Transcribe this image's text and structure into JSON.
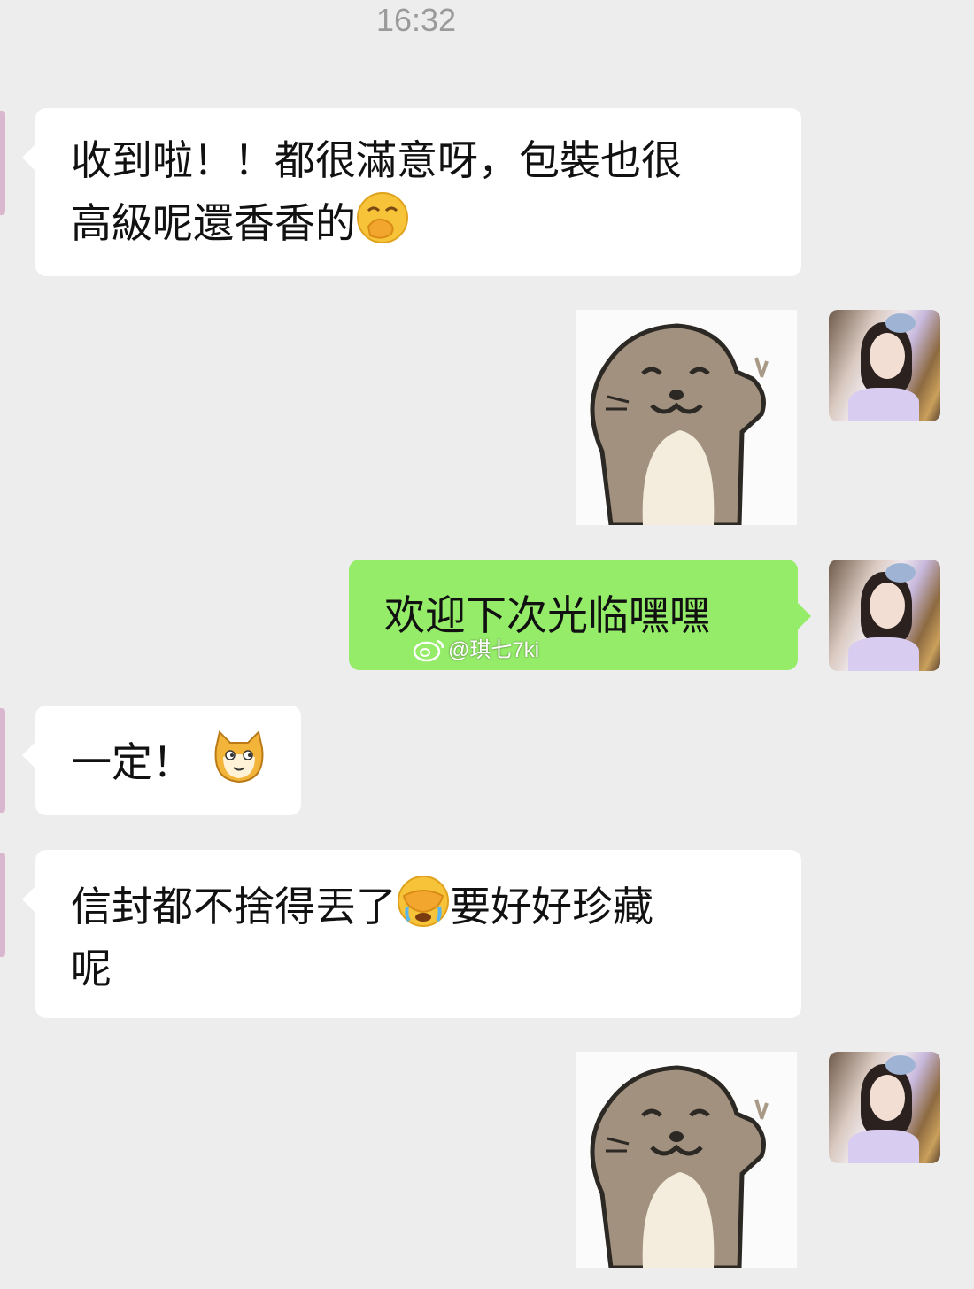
{
  "header": {
    "time": "16:32"
  },
  "messages": [
    {
      "side": "left",
      "type": "text",
      "line1": "收到啦！！都很滿意呀，包裝也很",
      "line2": "高級呢還香香的",
      "emoji": "hand-over-mouth-emoji"
    },
    {
      "side": "right",
      "type": "sticker",
      "sticker": "otter-waving-sticker"
    },
    {
      "side": "right",
      "type": "text",
      "text": "欢迎下次光临嘿嘿"
    },
    {
      "side": "left",
      "type": "text",
      "text": "一定！",
      "emoji": "doge-cat-emoji"
    },
    {
      "side": "left",
      "type": "text",
      "line1_a": "信封都不捨得丟了",
      "line1_b": "要好好珍藏",
      "line2": "呢",
      "emoji": "facepalm-crying-emoji"
    },
    {
      "side": "right",
      "type": "sticker",
      "sticker": "otter-waving-sticker"
    }
  ],
  "watermark": {
    "text": "@琪七7ki"
  },
  "colors": {
    "background": "#ededed",
    "incoming": "#ffffff",
    "outgoing": "#95ec69"
  }
}
